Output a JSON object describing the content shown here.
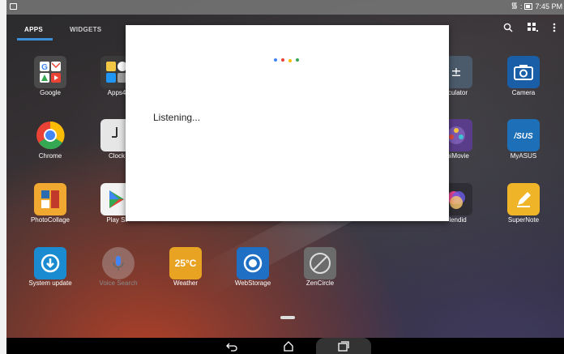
{
  "status_bar": {
    "time": "7:45 PM"
  },
  "tabs": [
    {
      "label": "APPS"
    },
    {
      "label": "WIDGETS"
    }
  ],
  "toolbar": {
    "search_icon": "search-icon",
    "grid_icon": "grid-sort-icon",
    "menu_icon": "overflow-menu-icon"
  },
  "apps": [
    {
      "label": "Google",
      "icon": "google-folder-icon"
    },
    {
      "label": "Apps4",
      "icon": "apps4-folder-icon"
    },
    {
      "label": "culator",
      "icon": "calculator-icon"
    },
    {
      "label": "Camera",
      "icon": "camera-icon"
    },
    {
      "label": "Chrome",
      "icon": "chrome-icon"
    },
    {
      "label": "Clock",
      "icon": "clock-icon"
    },
    {
      "label": "niMovie",
      "icon": "minimovie-icon"
    },
    {
      "label": "MyASUS",
      "icon": "myasus-icon"
    },
    {
      "label": "PhotoCollage",
      "icon": "photocollage-icon"
    },
    {
      "label": "Play St",
      "icon": "play-store-icon"
    },
    {
      "label": "lendid",
      "icon": "splendid-icon"
    },
    {
      "label": "SuperNote",
      "icon": "supernote-icon"
    },
    {
      "label": "System update",
      "icon": "system-update-icon"
    },
    {
      "label": "Voice Search",
      "icon": "microphone-icon"
    },
    {
      "label": "Weather",
      "icon": "weather-icon",
      "text": "25°C"
    },
    {
      "label": "WebStorage",
      "icon": "webstorage-icon"
    },
    {
      "label": "ZenCircle",
      "icon": "zencircle-icon"
    }
  ],
  "dialog": {
    "status_text": "Listening...",
    "dot_colors": [
      "#4285F4",
      "#EA4335",
      "#FBBC05",
      "#34A853"
    ]
  },
  "navbar": {
    "back": "back-icon",
    "home": "home-icon",
    "recents": "recents-icon"
  }
}
